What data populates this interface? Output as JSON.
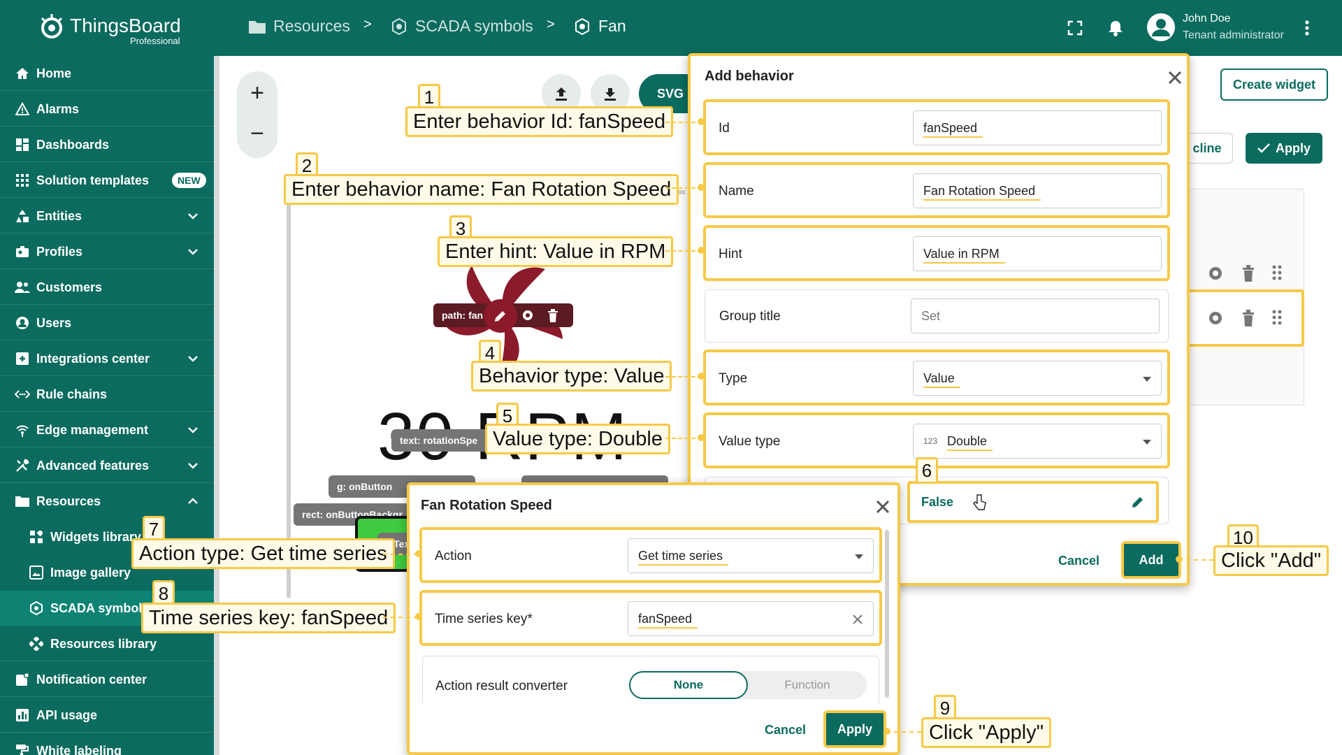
{
  "app": {
    "name": "ThingsBoard",
    "edition": "Professional"
  },
  "breadcrumb": [
    {
      "label": "Resources",
      "icon": "folder-icon"
    },
    {
      "label": "SCADA symbols",
      "icon": "scada-icon"
    },
    {
      "label": "Fan",
      "icon": "scada-icon"
    }
  ],
  "breadcrumb_sep": ">",
  "user": {
    "name": "John Doe",
    "role": "Tenant administrator"
  },
  "sidebar": {
    "items": [
      {
        "label": "Home",
        "icon": "home-icon"
      },
      {
        "label": "Alarms",
        "icon": "alarm-icon"
      },
      {
        "label": "Dashboards",
        "icon": "dashboard-icon"
      },
      {
        "label": "Solution templates",
        "icon": "apps-icon",
        "badge": "NEW"
      },
      {
        "label": "Entities",
        "icon": "entities-icon",
        "expand": "down"
      },
      {
        "label": "Profiles",
        "icon": "profiles-icon",
        "expand": "down"
      },
      {
        "label": "Customers",
        "icon": "customers-icon"
      },
      {
        "label": "Users",
        "icon": "user-icon"
      },
      {
        "label": "Integrations center",
        "icon": "integrations-icon",
        "expand": "down"
      },
      {
        "label": "Rule chains",
        "icon": "rule-chains-icon"
      },
      {
        "label": "Edge management",
        "icon": "edge-icon",
        "expand": "down"
      },
      {
        "label": "Advanced features",
        "icon": "tools-icon",
        "expand": "down"
      },
      {
        "label": "Resources",
        "icon": "folder-icon",
        "expand": "up"
      },
      {
        "label": "Widgets library",
        "icon": "widgets-icon",
        "sub": true
      },
      {
        "label": "Image gallery",
        "icon": "image-icon",
        "sub": true
      },
      {
        "label": "SCADA symbols",
        "icon": "scada-icon",
        "sub": true,
        "active": true
      },
      {
        "label": "Resources library",
        "icon": "resources-library-icon",
        "sub": true
      },
      {
        "label": "Notification center",
        "icon": "notification-icon"
      },
      {
        "label": "API usage",
        "icon": "api-usage-icon"
      },
      {
        "label": "White labeling",
        "icon": "white-labeling-icon"
      }
    ]
  },
  "canvas": {
    "zoom_in": "+",
    "zoom_out": "−",
    "svg_tab": "SVG",
    "rpm_text": "30 RPM",
    "tags": {
      "path_fan": "path:  fan",
      "text_rotation": "text:  rotationSpe",
      "g_onbutton": "g:  onButton",
      "rect_onbutton": "rect:  onButtonBackgr",
      "onbutton_text": "onTex"
    }
  },
  "right_panel": {
    "create_widget": "Create widget",
    "decline": "cline",
    "apply": "Apply"
  },
  "add_behavior": {
    "title": "Add behavior",
    "fields": [
      {
        "label": "Id",
        "value": "fanSpeed"
      },
      {
        "label": "Name",
        "value": "Fan Rotation Speed"
      },
      {
        "label": "Hint",
        "value": "Value in RPM"
      },
      {
        "label": "Group title",
        "placeholder": "Set"
      },
      {
        "label": "Type",
        "value": "Value"
      },
      {
        "label": "Value type",
        "value": "Double",
        "prefix": "123"
      }
    ],
    "default_value": "False",
    "cancel": "Cancel",
    "add": "Add"
  },
  "fan_dialog": {
    "title": "Fan Rotation Speed",
    "action_label": "Action",
    "action_value": "Get time series",
    "key_label": "Time series key*",
    "key_value": "fanSpeed",
    "converter_label": "Action result converter",
    "converter_options": [
      "None",
      "Function"
    ],
    "cancel": "Cancel",
    "apply": "Apply"
  },
  "callouts": [
    {
      "n": "1",
      "text": "Enter behavior Id: fanSpeed"
    },
    {
      "n": "2",
      "text": "Enter behavior name: Fan Rotation Speed"
    },
    {
      "n": "3",
      "text": "Enter hint: Value in RPM"
    },
    {
      "n": "4",
      "text": "Behavior type: Value"
    },
    {
      "n": "5",
      "text": "Value type: Double"
    },
    {
      "n": "6",
      "text": ""
    },
    {
      "n": "7",
      "text": "Action type: Get time series"
    },
    {
      "n": "8",
      "text": "Time series key: fanSpeed"
    },
    {
      "n": "9",
      "text": "Click \"Apply\""
    },
    {
      "n": "10",
      "text": "Click \"Add\""
    }
  ],
  "colors": {
    "brand": "#0b6b5e",
    "highlight": "#f7c948",
    "fan": "#8b1a2b"
  }
}
